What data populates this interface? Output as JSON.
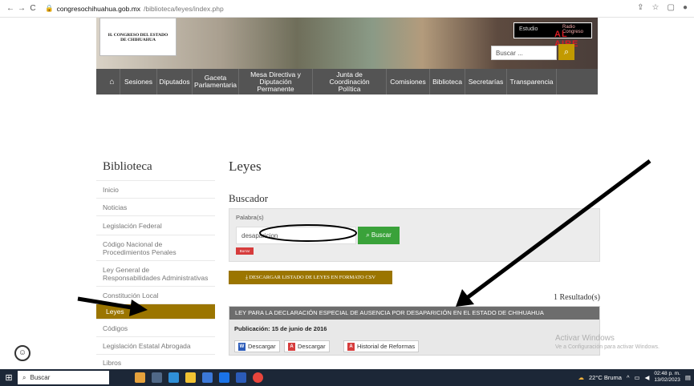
{
  "browser": {
    "url_host": "congresochihuahua.gob.mx",
    "url_path": "/biblioteca/leyes/index.php"
  },
  "header": {
    "logo_line1": "H. CONGRESO DEL ESTADO",
    "logo_line2": "DE CHIHUAHUA",
    "radio_small": "Radio Congreso",
    "radio_big": "AL AIRE",
    "radio_left": "Estudio",
    "search_placeholder": "Buscar ..."
  },
  "menu": {
    "items": [
      {
        "label": "Sesiones"
      },
      {
        "label": "Diputados"
      },
      {
        "label": "Gaceta Parlamentaria"
      },
      {
        "label": "Mesa Directiva y Diputación Permanente"
      },
      {
        "label": "Junta de Coordinación Política"
      },
      {
        "label": "Comisiones"
      },
      {
        "label": "Biblioteca"
      },
      {
        "label": "Secretarías"
      },
      {
        "label": "Transparencia"
      }
    ]
  },
  "sidebar": {
    "title": "Biblioteca",
    "items": [
      {
        "label": "Inicio"
      },
      {
        "label": "Noticias"
      },
      {
        "label": "Legislación Federal"
      },
      {
        "label": "Código Nacional de Procedimientos Penales"
      },
      {
        "label": "Ley General de Responsabilidades Administrativas"
      },
      {
        "label": "Constitución Local"
      },
      {
        "label": "Leyes"
      },
      {
        "label": "Códigos"
      },
      {
        "label": "Legislación Estatal Abrogada"
      },
      {
        "label": "Libros"
      }
    ]
  },
  "main": {
    "title": "Leyes",
    "search_heading": "Buscador",
    "field_label": "Palabra(s)",
    "field_value": "desaparicion",
    "search_button": "Buscar",
    "clear_button": "Borrar",
    "csv_button": "DESCARGAR LISTADO DE LEYES EN FORMATO CSV",
    "results_count": "1 Resultado(s)",
    "result": {
      "title": "LEY PARA LA DECLARACIÓN ESPECIAL DE AUSENCIA POR DESAPARICIÓN EN EL ESTADO DE CHIHUAHUA",
      "pub_label": "Publicación:",
      "pub_date": "15 de junio de 2016",
      "btn_word": "Descargar",
      "btn_pdf": "Descargar",
      "btn_history": "Historial de Reformas"
    }
  },
  "watermark": {
    "line1": "Activar Windows",
    "line2": "Ve a Configuración para activar Windows."
  },
  "taskbar": {
    "search_label": "Buscar",
    "weather": "22°C  Bruma",
    "time": "02:48 p. m.",
    "date": "13/02/2023"
  },
  "colors": {
    "accent_gold": "#9b7500",
    "menu_gray": "#545454",
    "buscar_green": "#3aa23a",
    "borrar_red": "#d63c3c"
  },
  "icons": {
    "home": "home-icon",
    "accessibility": "accessibility-icon",
    "search": "search-icon"
  }
}
